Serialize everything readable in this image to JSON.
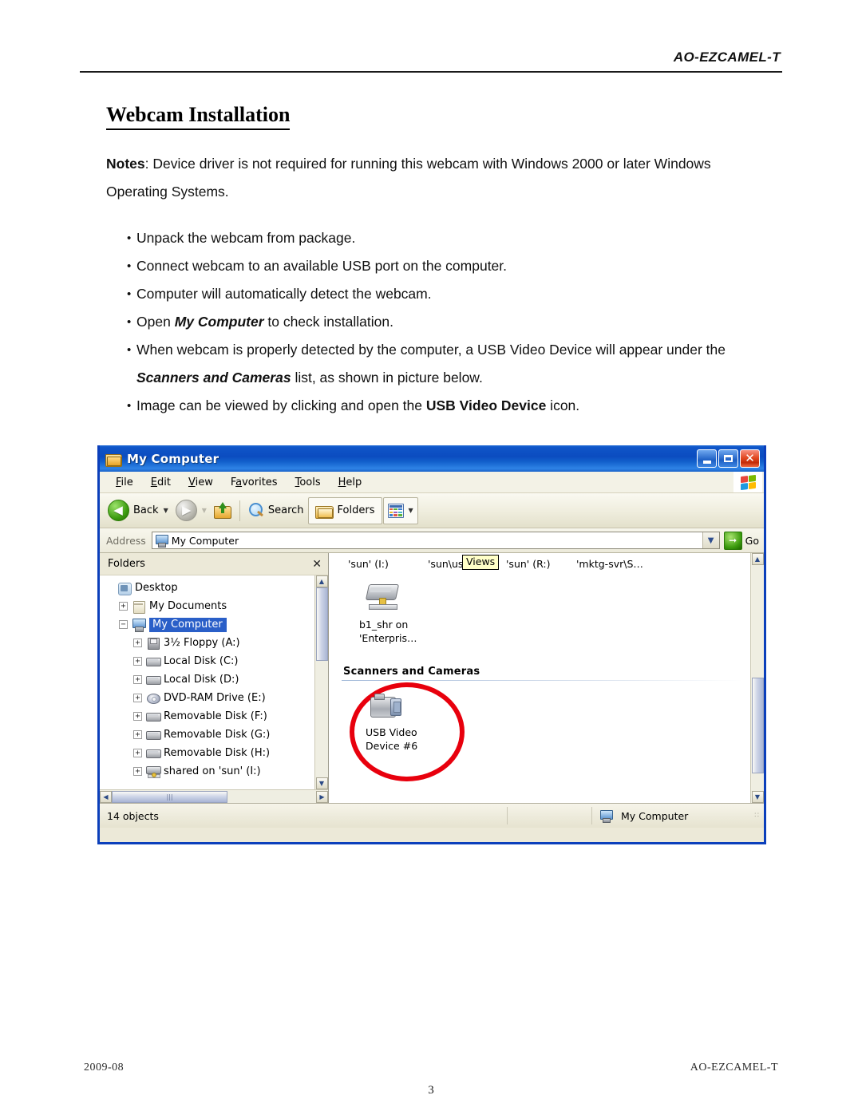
{
  "header": {
    "product_code": "AO-EZCAMEL-T"
  },
  "title": "Webcam Installation",
  "notes": {
    "label": "Notes",
    "text": ": Device driver is not required for running this webcam with Windows 2000 or later Windows Operating Systems."
  },
  "bullets": [
    {
      "marker": "•",
      "parts": [
        {
          "t": "Unpack the webcam from package.",
          "style": "normal"
        }
      ]
    },
    {
      "marker": "•",
      "parts": [
        {
          "t": "Connect webcam to an available USB port on the computer.",
          "style": "normal"
        }
      ]
    },
    {
      "marker": "•",
      "parts": [
        {
          "t": "Computer will automatically detect the webcam.",
          "style": "normal"
        }
      ]
    },
    {
      "marker": "•",
      "parts": [
        {
          "t": "Open ",
          "style": "normal"
        },
        {
          "t": "My Computer",
          "style": "bold-italic"
        },
        {
          "t": " to check installation.",
          "style": "normal"
        }
      ]
    },
    {
      "marker": "•",
      "parts": [
        {
          "t": "When webcam is properly detected by the computer, a USB Video Device will appear under the ",
          "style": "normal"
        },
        {
          "t": "Scanners and Cameras",
          "style": "bold-italic"
        },
        {
          "t": " list, as shown in picture below.",
          "style": "normal"
        }
      ]
    },
    {
      "marker": "•",
      "parts": [
        {
          "t": "Image can be viewed by clicking and open the ",
          "style": "normal"
        },
        {
          "t": "USB Video Device",
          "style": "bold"
        },
        {
          "t": " icon.",
          "style": "normal"
        }
      ]
    }
  ],
  "explorer": {
    "window_title": "My Computer",
    "window_buttons": {
      "minimize": "–",
      "maximize": "□",
      "close": "✕"
    },
    "menu": [
      {
        "accel": "F",
        "rest": "ile"
      },
      {
        "accel": "E",
        "rest": "dit"
      },
      {
        "accel": "V",
        "rest": "iew"
      },
      {
        "pre": "F",
        "accel": "a",
        "rest": "vorites"
      },
      {
        "accel": "T",
        "rest": "ools"
      },
      {
        "accel": "H",
        "rest": "elp"
      }
    ],
    "toolbar": {
      "back_label": "Back",
      "forward_label": "",
      "up_label": "",
      "search_label": "Search",
      "folders_label": "Folders",
      "views_label": ""
    },
    "address": {
      "label": "Address",
      "value": "My Computer",
      "go_label": "Go"
    },
    "folders_pane": {
      "title": "Folders",
      "close": "✕",
      "tree": [
        {
          "label": "Desktop",
          "expander": "",
          "icon": "desktop-icon",
          "indent": 0,
          "selected": false
        },
        {
          "label": "My Documents",
          "expander": "+",
          "icon": "documents-icon",
          "indent": 1,
          "selected": false
        },
        {
          "label": "My Computer",
          "expander": "−",
          "icon": "computer-icon",
          "indent": 1,
          "selected": true
        },
        {
          "label": "3½ Floppy (A:)",
          "expander": "+",
          "icon": "floppy-icon",
          "indent": 2,
          "selected": false
        },
        {
          "label": "Local Disk (C:)",
          "expander": "+",
          "icon": "harddisk-icon",
          "indent": 2,
          "selected": false
        },
        {
          "label": "Local Disk (D:)",
          "expander": "+",
          "icon": "harddisk-icon",
          "indent": 2,
          "selected": false
        },
        {
          "label": "DVD-RAM Drive (E:)",
          "expander": "+",
          "icon": "dvd-icon",
          "indent": 2,
          "selected": false
        },
        {
          "label": "Removable Disk (F:)",
          "expander": "+",
          "icon": "harddisk-icon",
          "indent": 2,
          "selected": false
        },
        {
          "label": "Removable Disk (G:)",
          "expander": "+",
          "icon": "harddisk-icon",
          "indent": 2,
          "selected": false
        },
        {
          "label": "Removable Disk (H:)",
          "expander": "+",
          "icon": "harddisk-icon",
          "indent": 2,
          "selected": false
        },
        {
          "label": "shared on 'sun' (I:)",
          "expander": "+",
          "icon": "network-drive-icon",
          "indent": 2,
          "selected": false
        }
      ]
    },
    "content": {
      "network_row": [
        "'sun' (I:)",
        "'sun\\us",
        "'sun' (R:)",
        "'mktg-svr\\S…"
      ],
      "views_tooltip": "Views",
      "drive_item": {
        "line1": "b1_shr on",
        "line2": "'Enterpris…"
      },
      "section_heading": "Scanners and Cameras",
      "camera_item": {
        "line1": "USB Video",
        "line2": "Device #6"
      },
      "highlight_color": "#e8000d"
    },
    "statusbar": {
      "objects": "14 objects",
      "location": "My Computer"
    }
  },
  "footer": {
    "date": "2009-08",
    "product_code": "AO-EZCAMEL-T",
    "page_number": "3"
  }
}
